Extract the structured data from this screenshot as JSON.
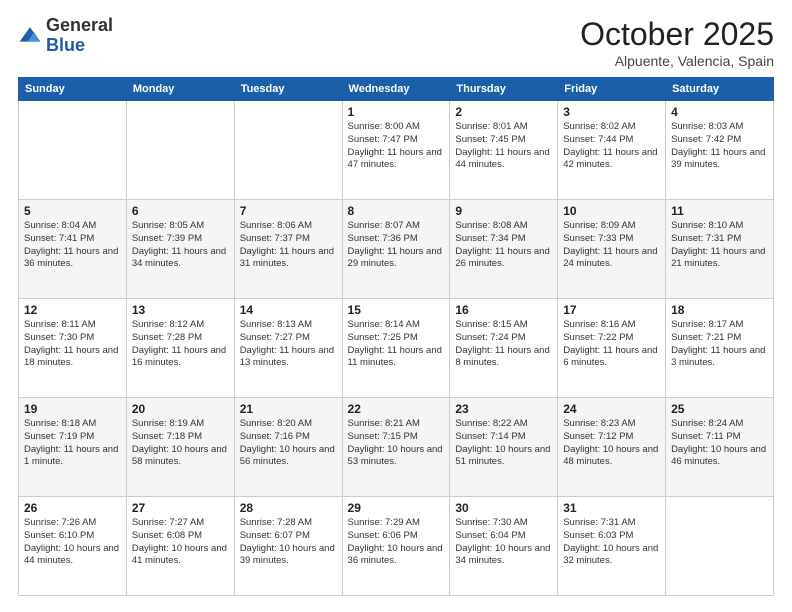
{
  "logo": {
    "general": "General",
    "blue": "Blue"
  },
  "header": {
    "month": "October 2025",
    "location": "Alpuente, Valencia, Spain"
  },
  "weekdays": [
    "Sunday",
    "Monday",
    "Tuesday",
    "Wednesday",
    "Thursday",
    "Friday",
    "Saturday"
  ],
  "weeks": [
    [
      {
        "day": "",
        "info": ""
      },
      {
        "day": "",
        "info": ""
      },
      {
        "day": "",
        "info": ""
      },
      {
        "day": "1",
        "info": "Sunrise: 8:00 AM\nSunset: 7:47 PM\nDaylight: 11 hours and 47 minutes."
      },
      {
        "day": "2",
        "info": "Sunrise: 8:01 AM\nSunset: 7:45 PM\nDaylight: 11 hours and 44 minutes."
      },
      {
        "day": "3",
        "info": "Sunrise: 8:02 AM\nSunset: 7:44 PM\nDaylight: 11 hours and 42 minutes."
      },
      {
        "day": "4",
        "info": "Sunrise: 8:03 AM\nSunset: 7:42 PM\nDaylight: 11 hours and 39 minutes."
      }
    ],
    [
      {
        "day": "5",
        "info": "Sunrise: 8:04 AM\nSunset: 7:41 PM\nDaylight: 11 hours and 36 minutes."
      },
      {
        "day": "6",
        "info": "Sunrise: 8:05 AM\nSunset: 7:39 PM\nDaylight: 11 hours and 34 minutes."
      },
      {
        "day": "7",
        "info": "Sunrise: 8:06 AM\nSunset: 7:37 PM\nDaylight: 11 hours and 31 minutes."
      },
      {
        "day": "8",
        "info": "Sunrise: 8:07 AM\nSunset: 7:36 PM\nDaylight: 11 hours and 29 minutes."
      },
      {
        "day": "9",
        "info": "Sunrise: 8:08 AM\nSunset: 7:34 PM\nDaylight: 11 hours and 26 minutes."
      },
      {
        "day": "10",
        "info": "Sunrise: 8:09 AM\nSunset: 7:33 PM\nDaylight: 11 hours and 24 minutes."
      },
      {
        "day": "11",
        "info": "Sunrise: 8:10 AM\nSunset: 7:31 PM\nDaylight: 11 hours and 21 minutes."
      }
    ],
    [
      {
        "day": "12",
        "info": "Sunrise: 8:11 AM\nSunset: 7:30 PM\nDaylight: 11 hours and 18 minutes."
      },
      {
        "day": "13",
        "info": "Sunrise: 8:12 AM\nSunset: 7:28 PM\nDaylight: 11 hours and 16 minutes."
      },
      {
        "day": "14",
        "info": "Sunrise: 8:13 AM\nSunset: 7:27 PM\nDaylight: 11 hours and 13 minutes."
      },
      {
        "day": "15",
        "info": "Sunrise: 8:14 AM\nSunset: 7:25 PM\nDaylight: 11 hours and 11 minutes."
      },
      {
        "day": "16",
        "info": "Sunrise: 8:15 AM\nSunset: 7:24 PM\nDaylight: 11 hours and 8 minutes."
      },
      {
        "day": "17",
        "info": "Sunrise: 8:16 AM\nSunset: 7:22 PM\nDaylight: 11 hours and 6 minutes."
      },
      {
        "day": "18",
        "info": "Sunrise: 8:17 AM\nSunset: 7:21 PM\nDaylight: 11 hours and 3 minutes."
      }
    ],
    [
      {
        "day": "19",
        "info": "Sunrise: 8:18 AM\nSunset: 7:19 PM\nDaylight: 11 hours and 1 minute."
      },
      {
        "day": "20",
        "info": "Sunrise: 8:19 AM\nSunset: 7:18 PM\nDaylight: 10 hours and 58 minutes."
      },
      {
        "day": "21",
        "info": "Sunrise: 8:20 AM\nSunset: 7:16 PM\nDaylight: 10 hours and 56 minutes."
      },
      {
        "day": "22",
        "info": "Sunrise: 8:21 AM\nSunset: 7:15 PM\nDaylight: 10 hours and 53 minutes."
      },
      {
        "day": "23",
        "info": "Sunrise: 8:22 AM\nSunset: 7:14 PM\nDaylight: 10 hours and 51 minutes."
      },
      {
        "day": "24",
        "info": "Sunrise: 8:23 AM\nSunset: 7:12 PM\nDaylight: 10 hours and 48 minutes."
      },
      {
        "day": "25",
        "info": "Sunrise: 8:24 AM\nSunset: 7:11 PM\nDaylight: 10 hours and 46 minutes."
      }
    ],
    [
      {
        "day": "26",
        "info": "Sunrise: 7:26 AM\nSunset: 6:10 PM\nDaylight: 10 hours and 44 minutes."
      },
      {
        "day": "27",
        "info": "Sunrise: 7:27 AM\nSunset: 6:08 PM\nDaylight: 10 hours and 41 minutes."
      },
      {
        "day": "28",
        "info": "Sunrise: 7:28 AM\nSunset: 6:07 PM\nDaylight: 10 hours and 39 minutes."
      },
      {
        "day": "29",
        "info": "Sunrise: 7:29 AM\nSunset: 6:06 PM\nDaylight: 10 hours and 36 minutes."
      },
      {
        "day": "30",
        "info": "Sunrise: 7:30 AM\nSunset: 6:04 PM\nDaylight: 10 hours and 34 minutes."
      },
      {
        "day": "31",
        "info": "Sunrise: 7:31 AM\nSunset: 6:03 PM\nDaylight: 10 hours and 32 minutes."
      },
      {
        "day": "",
        "info": ""
      }
    ]
  ]
}
